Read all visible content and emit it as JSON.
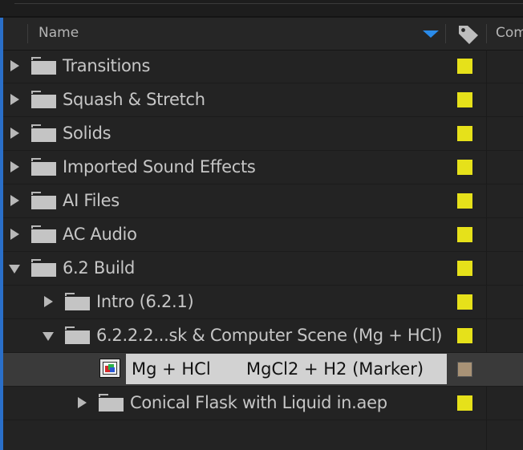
{
  "header": {
    "name_label": "Name",
    "comment_label": "Com",
    "sort_direction": "descending",
    "sort_color": "#2a8bea",
    "label_column_icon": "tag-icon"
  },
  "colors": {
    "label_yellow": "#e6e11a",
    "label_sandstone": "#a89276",
    "selection_highlight": "#d2d2d2",
    "accent_blue": "#2a6fc9"
  },
  "rows": [
    {
      "name": "Transitions",
      "type": "folder",
      "expanded": false,
      "depth": 0,
      "label_color": "#e6e11a"
    },
    {
      "name": "Squash & Stretch",
      "type": "folder",
      "expanded": false,
      "depth": 0,
      "label_color": "#e6e11a"
    },
    {
      "name": "Solids",
      "type": "folder",
      "expanded": false,
      "depth": 0,
      "label_color": "#e6e11a"
    },
    {
      "name": "Imported Sound Effects",
      "type": "folder",
      "expanded": false,
      "depth": 0,
      "label_color": "#e6e11a"
    },
    {
      "name": "AI Files",
      "type": "folder",
      "expanded": false,
      "depth": 0,
      "label_color": "#e6e11a"
    },
    {
      "name": "AC Audio",
      "type": "folder",
      "expanded": false,
      "depth": 0,
      "label_color": "#e6e11a"
    },
    {
      "name": "6.2 Build",
      "type": "folder",
      "expanded": true,
      "depth": 0,
      "label_color": "#e6e11a"
    },
    {
      "name": "Intro (6.2.1)",
      "type": "folder",
      "expanded": false,
      "depth": 1,
      "label_color": "#e6e11a"
    },
    {
      "name": "6.2.2.2...sk & Computer Scene (Mg + HCl)",
      "type": "folder",
      "expanded": true,
      "depth": 1,
      "label_color": "#e6e11a"
    },
    {
      "name": "Mg + HCl",
      "name_part2": "MgCl2 + H2 (Marker)",
      "type": "composition",
      "selected": true,
      "depth": 2,
      "label_color": "#a89276"
    },
    {
      "name": "Conical Flask with Liquid in.aep",
      "type": "folder",
      "expanded": false,
      "depth": 2,
      "label_color": "#e6e11a"
    }
  ]
}
